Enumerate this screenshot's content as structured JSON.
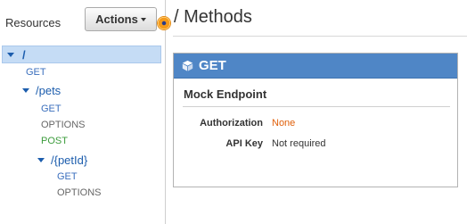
{
  "sidebar": {
    "header": "Resources",
    "actions_label": "Actions"
  },
  "tree": [
    {
      "type": "resource",
      "label": "/",
      "selected": true
    },
    {
      "type": "method",
      "label": "GET"
    },
    {
      "type": "resource",
      "label": "/pets"
    },
    {
      "type": "method",
      "label": "GET"
    },
    {
      "type": "method",
      "label": "OPTIONS"
    },
    {
      "type": "method",
      "label": "POST"
    },
    {
      "type": "resource",
      "label": "/{petId}"
    },
    {
      "type": "method",
      "label": "GET"
    },
    {
      "type": "method",
      "label": "OPTIONS"
    }
  ],
  "main": {
    "title": "/ Methods",
    "method_panel": {
      "method": "GET",
      "endpoint_title": "Mock Endpoint",
      "authorization_label": "Authorization",
      "authorization_value": "None",
      "api_key_label": "API Key",
      "api_key_value": "Not required"
    }
  },
  "colors": {
    "accent_blue": "#4f86c6",
    "selection": "#c5dcf5",
    "none_orange": "#e0600b",
    "post_green": "#3c9c3c"
  }
}
